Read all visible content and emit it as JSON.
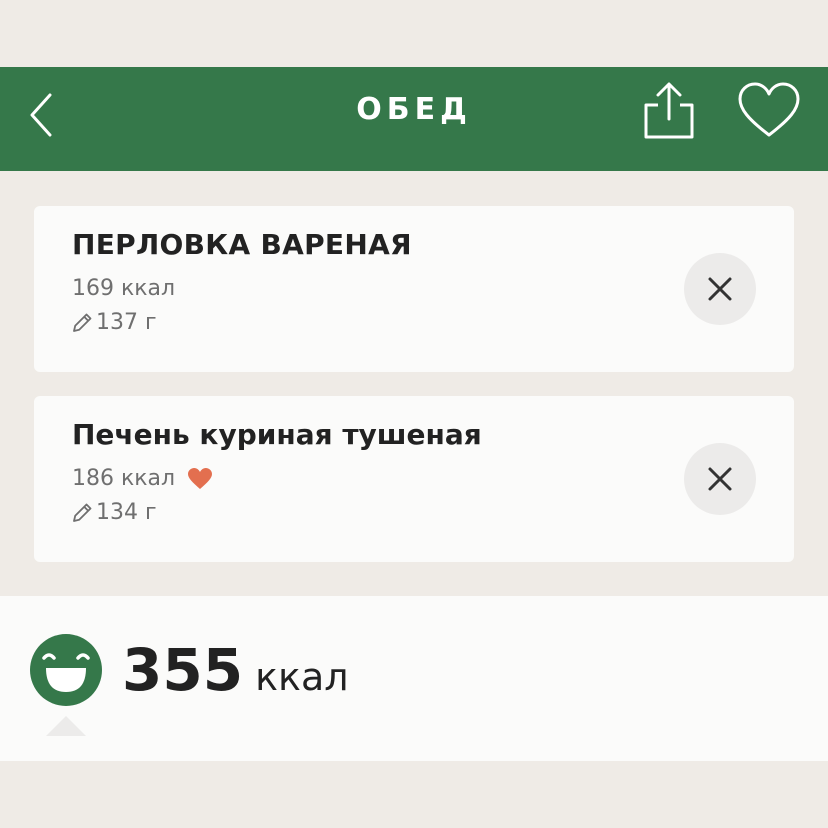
{
  "header": {
    "title": "ОБЕД",
    "back_icon": "chevron-left-icon",
    "share_icon": "share-icon",
    "favorite_icon": "heart-outline-icon",
    "color": "#35784a"
  },
  "items": [
    {
      "name": "ПЕРЛОВКА ВАРЕНАЯ",
      "kcal": "169 ккал",
      "weight": "137 г",
      "favorite": false,
      "remove_icon": "close-icon"
    },
    {
      "name": "Печень куриная тушеная",
      "kcal": "186 ккал",
      "weight": "134 г",
      "favorite": true,
      "favorite_color": "#e36f4f",
      "remove_icon": "close-icon"
    }
  ],
  "summary": {
    "total_value": "355",
    "total_unit": "ккал",
    "mood_icon": "smiley-face-icon"
  }
}
